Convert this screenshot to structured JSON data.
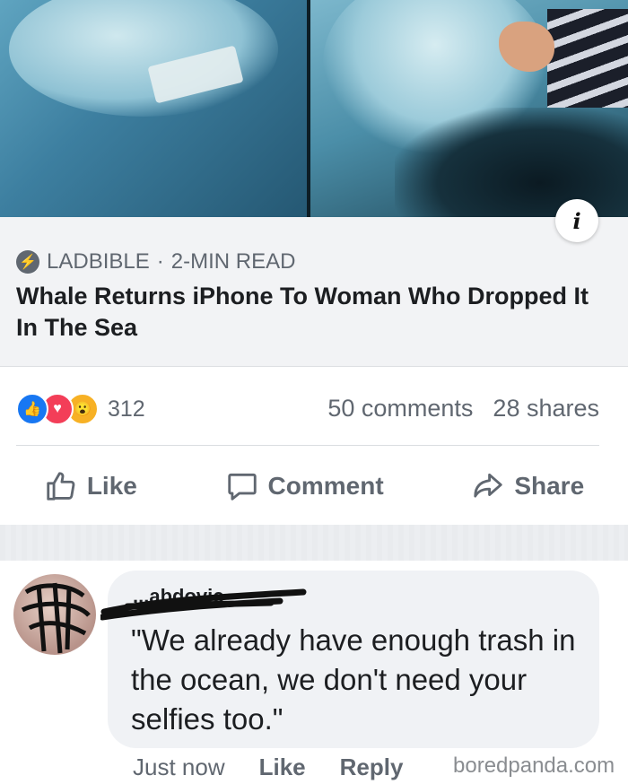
{
  "post": {
    "source": "LADBIBLE",
    "dot": "·",
    "read_time": "2-MIN READ",
    "headline": "Whale Returns iPhone To Woman Who Dropped It In The Sea"
  },
  "stats": {
    "reaction_count": "312",
    "comments": "50 comments",
    "shares": "28 shares"
  },
  "actions": {
    "like": "Like",
    "comment": "Comment",
    "share": "Share"
  },
  "comment": {
    "author": "...abdovic",
    "text": "\"We already have enough trash in the ocean, we don't need your selfies too.\"",
    "time": "Just now",
    "like": "Like",
    "reply": "Reply"
  },
  "watermark": "boredpanda.com",
  "icons": {
    "info": "info-icon",
    "source": "ladbible-bolt-icon",
    "reactions": [
      "like-reaction-icon",
      "love-reaction-icon",
      "wow-reaction-icon"
    ]
  },
  "colors": {
    "like_blue": "#1877f2",
    "love_red": "#f33e58",
    "wow_yellow": "#f7b125",
    "muted_text": "#606770",
    "bubble_bg": "#f0f2f5"
  }
}
